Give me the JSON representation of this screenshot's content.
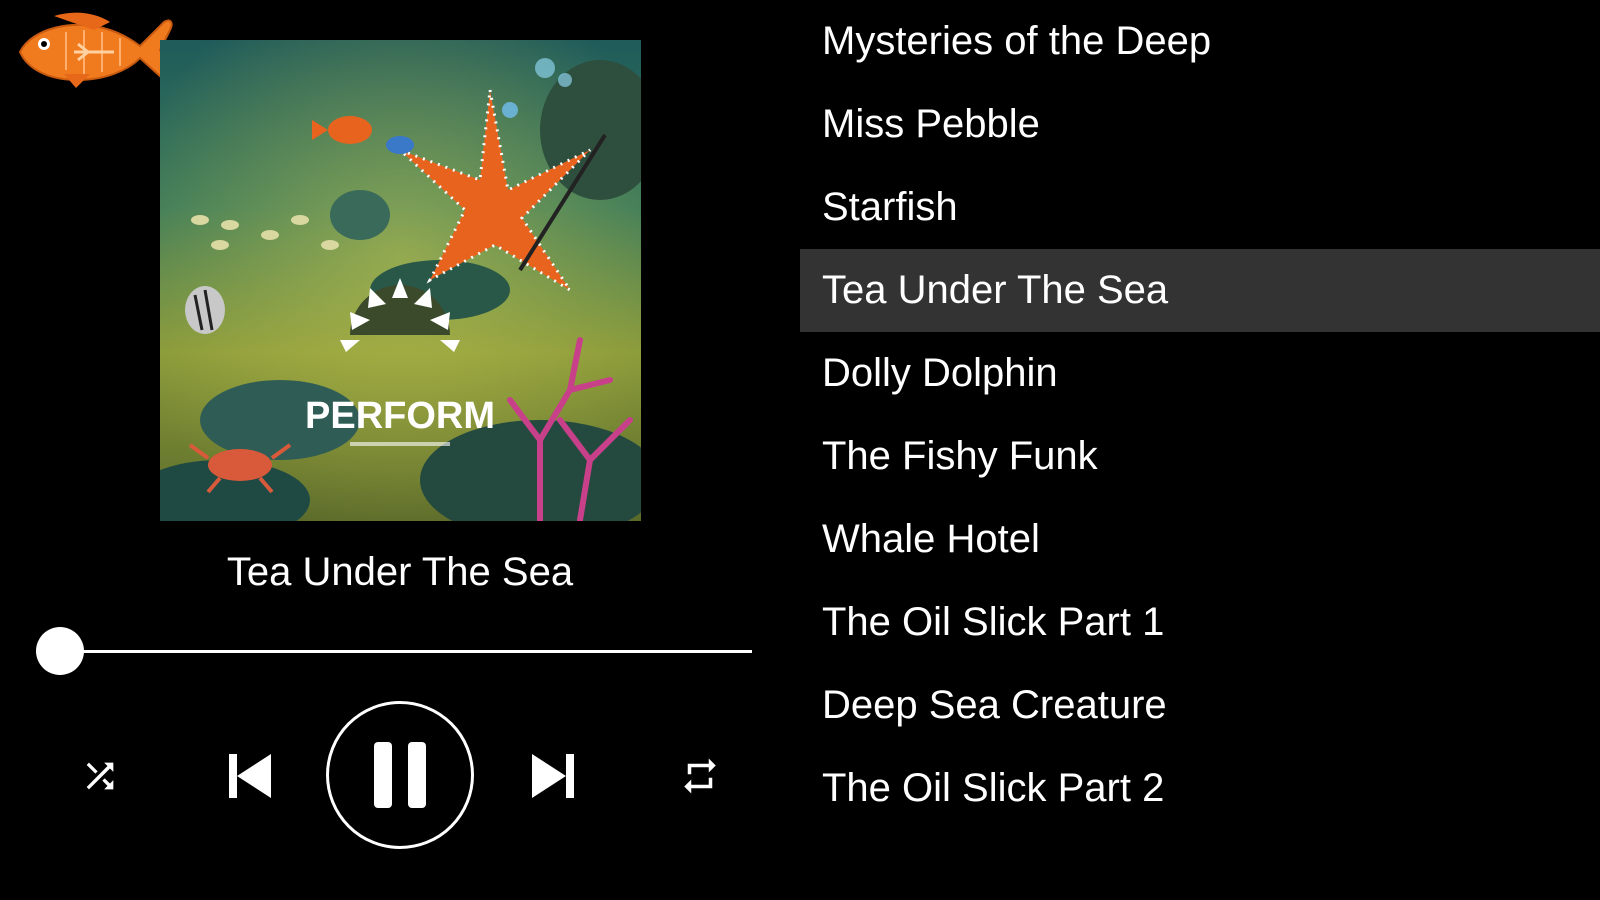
{
  "player": {
    "now_playing_title": "Tea Under The Sea",
    "album_art_text": "PERFORM",
    "progress_fraction": 0.0,
    "controls": {
      "shuffle_icon": "shuffle-icon",
      "previous_icon": "skip-previous-icon",
      "play_pause_icon": "pause-icon",
      "next_icon": "skip-next-icon",
      "repeat_icon": "repeat-icon"
    }
  },
  "logo": {
    "icon": "orange-fish-logo"
  },
  "playlist": {
    "active_index": 3,
    "tracks": [
      {
        "title": "Mysteries of the Deep"
      },
      {
        "title": "Miss Pebble"
      },
      {
        "title": "Starfish"
      },
      {
        "title": "Tea Under The Sea"
      },
      {
        "title": "Dolly Dolphin"
      },
      {
        "title": "The Fishy Funk"
      },
      {
        "title": "Whale Hotel"
      },
      {
        "title": "The Oil Slick Part 1"
      },
      {
        "title": "Deep Sea Creature"
      },
      {
        "title": "The Oil Slick Part 2"
      }
    ]
  },
  "colors": {
    "background": "#000000",
    "text": "#ffffff",
    "active_row": "#333333",
    "logo_orange": "#f07a1e"
  }
}
